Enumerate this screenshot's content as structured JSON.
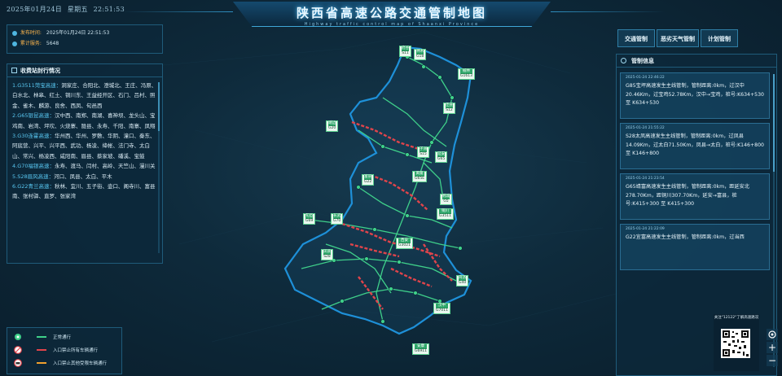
{
  "header": {
    "date": "2025年01月24日",
    "weekday": "星期五",
    "time": "22:51:53",
    "title": "陕西省高速公路交通管制地图",
    "subtitle": "Highway traffic control map of Shaanxi Province"
  },
  "release": {
    "time_label": "发布时间:",
    "time_value": "2025年01月24日 22:51:53",
    "service_label": "累计服务:",
    "service_value": "5648"
  },
  "toll": {
    "title": "收费站封行情况",
    "items": [
      {
        "hw": "1.G3511菏宝高速：",
        "text": "洞家庄、合阳北、澄城北、王庄、冯原、白水北、林皋、红土、铜川东、王益经开区、石门、吕村、照金、雀木、麟游、良舍、西凤、旬邑西"
      },
      {
        "hw": "2.G65银昆高速：",
        "text": "汉中西、南郑、南湖、喜神坝、龙头山、宝鸡南、岩湾、坪坎、火烧寨、陇县、永寿、千阳、南寨、凤翔"
      },
      {
        "hw": "3.G30连霍高速：",
        "text": "华州西、华州、罗敷、华阴、潼口、秦东、阿底营、兴平、兴平西、武功、杨凌、绛帐、法门寺、太白山、常兴、杨凌西、咸阳南、眉县、蔡家坡、磻溪、宝鼓"
      },
      {
        "hw": "4.G70福银高速：",
        "text": "永寿、渡马、闫村、高岭、天竺山、漫川关"
      },
      {
        "hw": "5.S28眉风高速：",
        "text": "河口、凤县、太白、平木"
      },
      {
        "hw": "6.G22青兰高速：",
        "text": "秋林、宜川、五子街、壶口、阁寺川、富县南、张村驿、直罗、张家湾"
      }
    ]
  },
  "legend": {
    "items": [
      {
        "label": "正常通行",
        "color": "#3fd08a"
      },
      {
        "label": "入口禁止所有车辆通行",
        "color": "#e0444b"
      },
      {
        "label": "入口禁止其他受限车辆通行",
        "color": "#f0a02e"
      }
    ]
  },
  "tabs": [
    "交通管制",
    "恶劣天气管制",
    "计划管制"
  ],
  "control": {
    "title": "管制信息",
    "cards": [
      {
        "time": "2025-01-24 22:46:22",
        "text": "G85宝坪高速发生主线管制，管制距离:0km，过汉中20.46Km，过宝鸡52.78Km，汉中→宝鸡，桩号:K634+530 至 K634+530"
      },
      {
        "time": "2025-01-24 21:55:22",
        "text": "S28太凤高速发生主线管制，管制距离:0km，过凤县14.09Km，过太白71.50Km，凤县→太白，桩号:K146+800 至 K146+800"
      },
      {
        "time": "2025-01-24 21:23:54",
        "text": "G65靖富高速发生主线管制，管制距离:0km，距延安北278.70Km，距铜川307.70Km，延安→富县，桩号:K415+300 至 K415+300"
      },
      {
        "time": "2025-01-24 21:22:09",
        "text": "G22宜富高速发生主线管制，管制距离:0km，过当西"
      }
    ]
  },
  "qr": {
    "caption": "关注\"12122\"了解高速路况"
  },
  "zoom": {
    "in": "+",
    "out": "−"
  },
  "stations": [
    {
      "name": "府谷",
      "code": "S11",
      "color": "#2fa76a"
    },
    {
      "name": "榆林",
      "code": "G1613",
      "color": "#2fa76a"
    },
    {
      "name": "神木",
      "code": "G18",
      "color": "#2fa76a"
    },
    {
      "name": "佳县",
      "code": "S12",
      "color": "#2fa76a"
    },
    {
      "name": "靖边",
      "code": "G20",
      "color": "#2fa76a"
    },
    {
      "name": "子洲",
      "code": "S15",
      "color": "#2fa76a"
    },
    {
      "name": "延安",
      "code": "G65",
      "color": "#2fa76a"
    },
    {
      "name": "富县",
      "code": "G22",
      "color": "#2fa76a"
    },
    {
      "name": "黄陵",
      "code": "G65E",
      "color": "#2fa76a"
    },
    {
      "name": "韩城",
      "code": "G5",
      "color": "#2fa76a"
    },
    {
      "name": "旬邑",
      "code": "G69",
      "color": "#2fa76a"
    },
    {
      "name": "长武",
      "code": "G70",
      "color": "#2fa76a"
    },
    {
      "name": "铜川",
      "code": "G3511",
      "color": "#2fa76a"
    },
    {
      "name": "凤县",
      "code": "S28",
      "color": "#2fa76a"
    },
    {
      "name": "西安",
      "code": "G3021",
      "color": "#2fa76a"
    },
    {
      "name": "商洛",
      "code": "G40",
      "color": "#2fa76a"
    },
    {
      "name": "汉中",
      "code": "G7011",
      "color": "#2fa76a"
    },
    {
      "name": "安康",
      "code": "G6911",
      "color": "#2fa76a"
    }
  ]
}
